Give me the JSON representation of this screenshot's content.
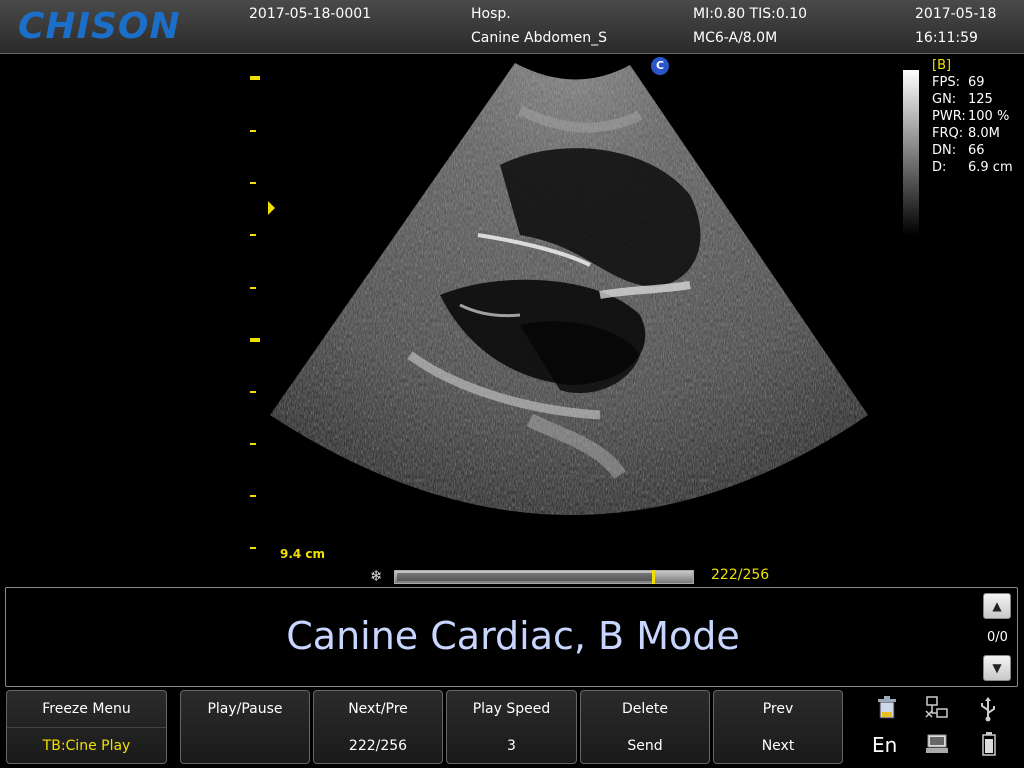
{
  "header": {
    "brand": "CHISON",
    "exam_id": "2017-05-18-0001",
    "hospital": "Hosp.",
    "preset": "Canine Abdomen_S",
    "mi_tis": "MI:0.80  TIS:0.10",
    "probe": "MC6-A/8.0M",
    "date": "2017-05-18",
    "time": "16:11:59"
  },
  "image": {
    "orientation_marker": "C",
    "depth_label": "9.4 cm"
  },
  "params": {
    "mode": "[B]",
    "rows": [
      {
        "key": "FPS:",
        "value": "69"
      },
      {
        "key": "GN:",
        "value": "125"
      },
      {
        "key": "PWR:",
        "value": "100 %"
      },
      {
        "key": "FRQ:",
        "value": "8.0M"
      },
      {
        "key": "DN:",
        "value": "66"
      },
      {
        "key": "D:",
        "value": "6.9 cm"
      }
    ]
  },
  "cine": {
    "icon": "snowflake-icon",
    "count": "222/256",
    "position_fraction": 0.867
  },
  "comment": {
    "text": "Canine Cardiac, B Mode",
    "page": "0/0",
    "up_icon": "arrow-up-icon",
    "down_icon": "arrow-down-icon"
  },
  "menu": {
    "freeze": {
      "top": "Freeze Menu",
      "bottom": "TB:Cine Play"
    },
    "buttons": [
      {
        "top": "Play/Pause",
        "bottom": ""
      },
      {
        "top": "Next/Pre",
        "bottom": "222/256"
      },
      {
        "top": "Play Speed",
        "bottom": "3"
      },
      {
        "top": "Delete",
        "bottom": "Send"
      },
      {
        "top": "Prev",
        "bottom": "Next"
      }
    ]
  },
  "system": {
    "language": "En",
    "icons": [
      "trash-icon",
      "network-icon",
      "usb-icon",
      "printer-icon",
      "battery-icon"
    ]
  },
  "colors": {
    "brand": "#1b6fc8",
    "accent_yellow": "#f0e000",
    "comment_text": "#c8d6ff",
    "orientation_marker": "#2a55c8"
  }
}
